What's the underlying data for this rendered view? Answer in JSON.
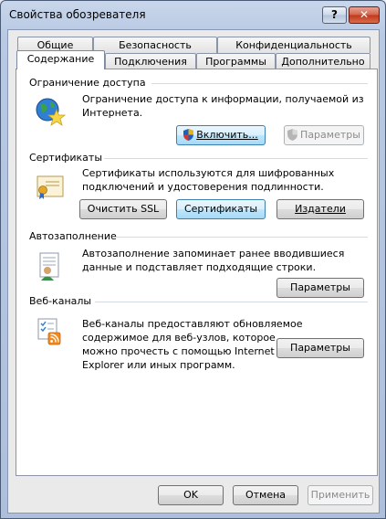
{
  "window": {
    "title": "Свойства обозревателя",
    "help_label": "?",
    "close_label": "✕"
  },
  "tabs": {
    "row1": [
      "Общие",
      "Безопасность",
      "Конфиденциальность"
    ],
    "row2": [
      "Содержание",
      "Подключения",
      "Программы",
      "Дополнительно"
    ],
    "active": "Содержание"
  },
  "content_advisor": {
    "title": "Ограничение доступа",
    "description_line1": "Ограничение доступа к информации, получаемой из",
    "description_line2": "Интернета.",
    "enable_button": "Включить...",
    "settings_button": "Параметры"
  },
  "certificates": {
    "title": "Сертификаты",
    "description_line1": "Сертификаты используются для шифрованных",
    "description_line2": "подключений и удостоверения подлинности.",
    "clear_ssl_button": "Очистить SSL",
    "certificates_button": "Сертификаты",
    "publishers_button": "Издатели"
  },
  "autocomplete": {
    "title": "Автозаполнение",
    "description_line1": "Автозаполнение запоминает ранее вводившиеся",
    "description_line2": "данные и подставляет подходящие строки.",
    "settings_button": "Параметры"
  },
  "feeds": {
    "title": "Веб-каналы",
    "description_line1": "Веб-каналы предоставляют обновляемое",
    "description_line2": "содержимое для веб-узлов, которое",
    "description_line3": "можно прочесть с помощью Internet",
    "description_line4": "Explorer или иных программ.",
    "settings_button": "Параметры"
  },
  "dialog_buttons": {
    "ok": "OK",
    "cancel": "Отмена",
    "apply": "Применить"
  },
  "colors": {
    "title_bar": "#b8c9e3",
    "close_button": "#c3361c",
    "focused_button": "#bee6fd",
    "disabled_text": "#8c8c8c"
  },
  "icons": {
    "content_advisor": "globe-star-icon",
    "certificates": "certificate-icon",
    "autocomplete": "user-form-icon",
    "feeds": "rss-feed-icon",
    "uac": "uac-shield-icon"
  }
}
